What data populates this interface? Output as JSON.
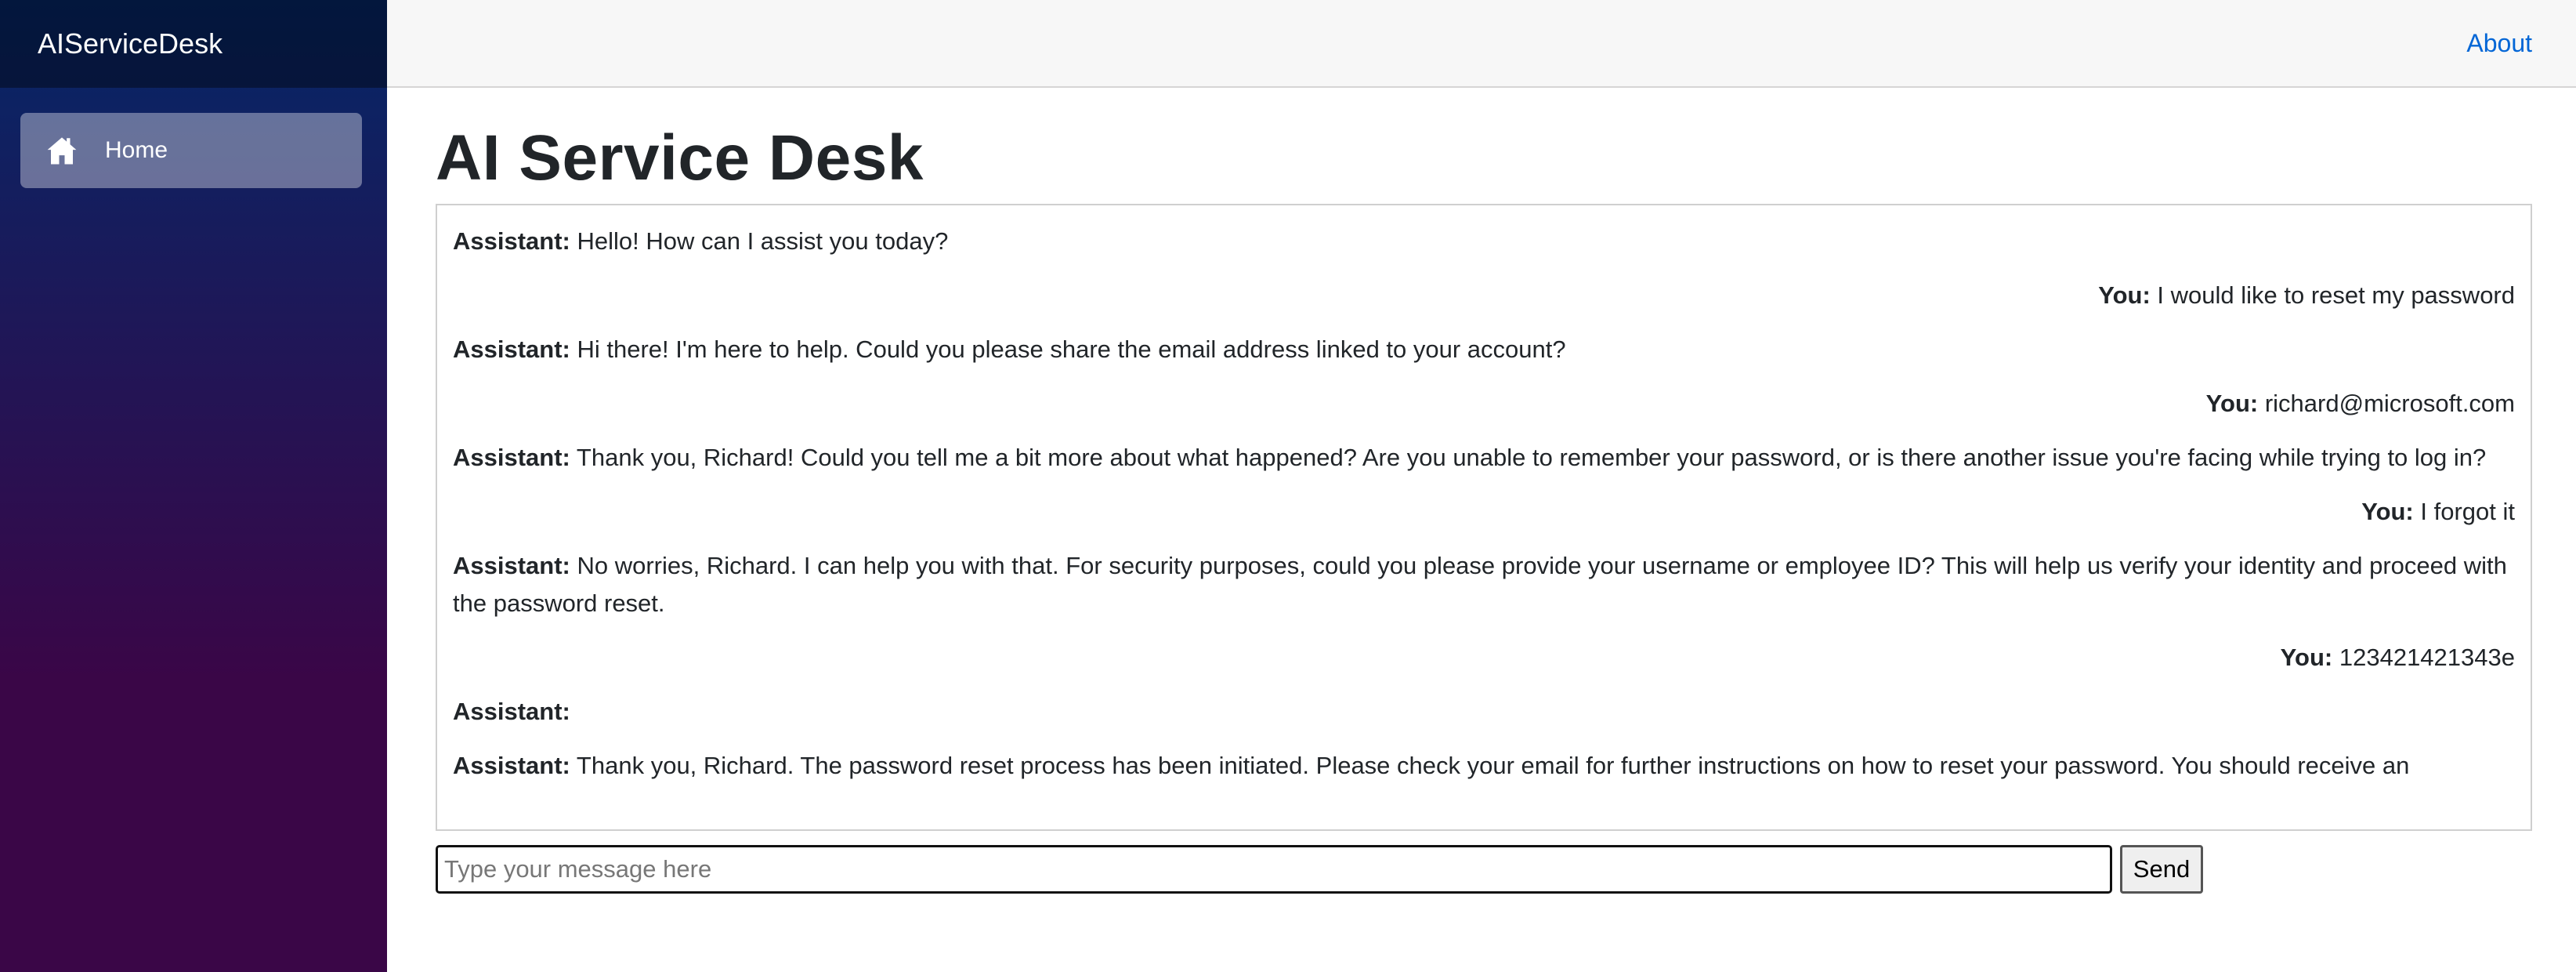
{
  "sidebar": {
    "brand": "AIServiceDesk",
    "items": [
      {
        "label": "Home",
        "icon": "home-icon",
        "active": true
      }
    ]
  },
  "topbar": {
    "about_link": "About"
  },
  "page": {
    "title": "AI Service Desk"
  },
  "chat": {
    "messages": [
      {
        "sender": "Assistant:",
        "text": " Hello! How can I assist you today?",
        "role": "assistant"
      },
      {
        "sender": "You:",
        "text": " I would like to reset my password",
        "role": "user"
      },
      {
        "sender": "Assistant:",
        "text": " Hi there! I'm here to help. Could you please share the email address linked to your account?",
        "role": "assistant"
      },
      {
        "sender": "You:",
        "text": " richard@microsoft.com",
        "role": "user"
      },
      {
        "sender": "Assistant:",
        "text": " Thank you, Richard! Could you tell me a bit more about what happened? Are you unable to remember your password, or is there another issue you're facing while trying to log in?",
        "role": "assistant"
      },
      {
        "sender": "You:",
        "text": " I forgot it",
        "role": "user"
      },
      {
        "sender": "Assistant:",
        "text": " No worries, Richard. I can help you with that. For security purposes, could you please provide your username or employee ID? This will help us verify your identity and proceed with the password reset.",
        "role": "assistant"
      },
      {
        "sender": "You:",
        "text": " 123421421343e",
        "role": "user"
      },
      {
        "sender": "Assistant:",
        "text": "",
        "role": "assistant"
      },
      {
        "sender": "Assistant:",
        "text": " Thank you, Richard. The password reset process has been initiated. Please check your email for further instructions on how to reset your password. You should receive an",
        "role": "assistant"
      }
    ]
  },
  "composer": {
    "placeholder": "Type your message here",
    "value": "",
    "send_label": "Send"
  },
  "colors": {
    "sidebar_top": "#052767",
    "sidebar_bottom": "#3a0647",
    "link": "#0366d6",
    "topbar_bg": "#f7f7f7"
  }
}
